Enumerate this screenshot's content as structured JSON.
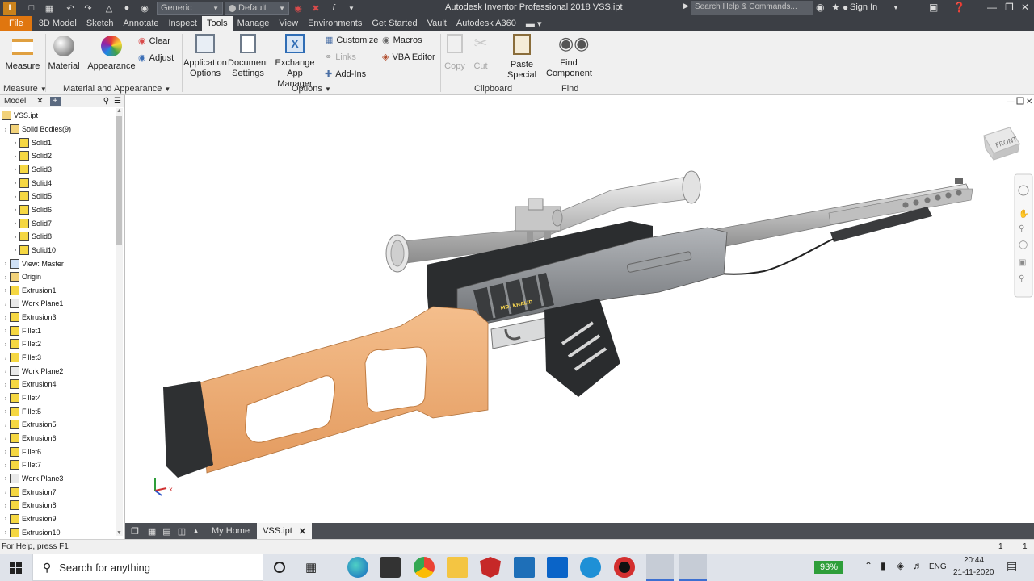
{
  "window": {
    "title": "Autodesk Inventor Professional 2018    VSS.ipt",
    "appearance_dropdown": "Generic",
    "material_dropdown": "Default",
    "search_placeholder": "Search Help & Commands...",
    "sign_in": "Sign In"
  },
  "ribbon_tabs": [
    "File",
    "3D Model",
    "Sketch",
    "Annotate",
    "Inspect",
    "Tools",
    "Manage",
    "View",
    "Environments",
    "Get Started",
    "Vault",
    "Autodesk A360"
  ],
  "active_tab": "Tools",
  "ribbon": {
    "measure": "Measure",
    "material": "Material",
    "appearance": "Appearance",
    "clear": "Clear",
    "adjust": "Adjust",
    "application_options_1": "Application",
    "application_options_2": "Options",
    "document_settings_1": "Document",
    "document_settings_2": "Settings",
    "exchange_1": "Exchange",
    "exchange_2": "App Manager",
    "customize": "Customize",
    "links": "Links",
    "addins": "Add-Ins",
    "macros": "Macros",
    "vba_editor": "VBA Editor",
    "copy": "Copy",
    "cut": "Cut",
    "paste_special_1": "Paste",
    "paste_special_2": "Special",
    "find_component_1": "Find",
    "find_component_2": "Component",
    "panels": {
      "measure": "Measure",
      "material_appearance": "Material and Appearance",
      "options": "Options",
      "clipboard": "Clipboard",
      "find": "Find"
    }
  },
  "browser": {
    "tab": "Model",
    "root": "VSS.ipt",
    "items": [
      {
        "label": "Solid Bodies(9)",
        "level": 0,
        "icon": "folder-icon"
      },
      {
        "label": "Solid1",
        "level": 1,
        "icon": "solid-body-icon"
      },
      {
        "label": "Solid2",
        "level": 1,
        "icon": "solid-body-icon"
      },
      {
        "label": "Solid3",
        "level": 1,
        "icon": "solid-body-icon"
      },
      {
        "label": "Solid4",
        "level": 1,
        "icon": "solid-body-icon"
      },
      {
        "label": "Solid5",
        "level": 1,
        "icon": "solid-body-icon"
      },
      {
        "label": "Solid6",
        "level": 1,
        "icon": "solid-body-icon"
      },
      {
        "label": "Solid7",
        "level": 1,
        "icon": "solid-body-icon"
      },
      {
        "label": "Solid8",
        "level": 1,
        "icon": "solid-body-icon"
      },
      {
        "label": "Solid10",
        "level": 1,
        "icon": "solid-body-icon"
      },
      {
        "label": "View: Master",
        "level": 0,
        "icon": "view-icon"
      },
      {
        "label": "Origin",
        "level": 0,
        "icon": "folder-icon"
      },
      {
        "label": "Extrusion1",
        "level": 0,
        "icon": "extrusion-icon"
      },
      {
        "label": "Work Plane1",
        "level": 0,
        "icon": "work-plane-icon"
      },
      {
        "label": "Extrusion3",
        "level": 0,
        "icon": "extrusion-icon"
      },
      {
        "label": "Fillet1",
        "level": 0,
        "icon": "fillet-icon"
      },
      {
        "label": "Fillet2",
        "level": 0,
        "icon": "fillet-icon"
      },
      {
        "label": "Fillet3",
        "level": 0,
        "icon": "fillet-icon"
      },
      {
        "label": "Work Plane2",
        "level": 0,
        "icon": "work-plane-icon"
      },
      {
        "label": "Extrusion4",
        "level": 0,
        "icon": "extrusion-icon"
      },
      {
        "label": "Fillet4",
        "level": 0,
        "icon": "fillet-icon"
      },
      {
        "label": "Fillet5",
        "level": 0,
        "icon": "fillet-icon"
      },
      {
        "label": "Extrusion5",
        "level": 0,
        "icon": "extrusion-icon"
      },
      {
        "label": "Extrusion6",
        "level": 0,
        "icon": "extrusion-icon"
      },
      {
        "label": "Fillet6",
        "level": 0,
        "icon": "fillet-icon"
      },
      {
        "label": "Fillet7",
        "level": 0,
        "icon": "fillet-icon"
      },
      {
        "label": "Work Plane3",
        "level": 0,
        "icon": "work-plane-icon"
      },
      {
        "label": "Extrusion7",
        "level": 0,
        "icon": "extrusion-icon"
      },
      {
        "label": "Extrusion8",
        "level": 0,
        "icon": "extrusion-icon"
      },
      {
        "label": "Extrusion9",
        "level": 0,
        "icon": "extrusion-icon"
      },
      {
        "label": "Extrusion10",
        "level": 0,
        "icon": "extrusion-icon"
      }
    ]
  },
  "viewport": {
    "viewcube_face": "FRONT",
    "engraving": "MD. KHALID",
    "axis_x": "x"
  },
  "doc_tabs": [
    "My Home",
    "VSS.ipt"
  ],
  "status": {
    "help": "For Help, press F1",
    "count_a": "1",
    "count_b": "1"
  },
  "taskbar": {
    "search": "Search for anything",
    "battery": "93%",
    "language": "ENG",
    "time": "20:44",
    "date": "21-11-2020"
  },
  "colors": {
    "accent": "#e0760f",
    "titlebar": "#3c3f45",
    "stock": "#eaa36b",
    "receiver": "#8a8d91",
    "dark_parts": "#2c2e30"
  }
}
